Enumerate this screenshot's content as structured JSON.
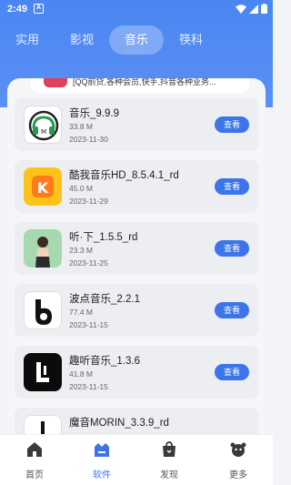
{
  "status": {
    "time": "2:49",
    "badge": "A"
  },
  "tabs": [
    {
      "label": "实用"
    },
    {
      "label": "影视"
    },
    {
      "label": "音乐"
    },
    {
      "label": "筷科"
    }
  ],
  "peek_text": "[QQ前贷,各种会员,快手,抖音各种业务...",
  "apps": [
    {
      "name": "音乐_9.9.9",
      "size": "33.8 M",
      "date": "2023-11-30",
      "button": "查看",
      "icon": "headphones-icon"
    },
    {
      "name": "酷我音乐HD_8.5.4.1_rd",
      "size": "45.0 M",
      "date": "2023-11-29",
      "button": "查看",
      "icon": "kuwo-logo-icon"
    },
    {
      "name": "听·下_1.5.5_rd",
      "size": "23.3 M",
      "date": "2023-11-25",
      "button": "查看",
      "icon": "singer-illustration-icon"
    },
    {
      "name": "波点音乐_2.2.1",
      "size": "77.4 M",
      "date": "2023-11-15",
      "button": "查看",
      "icon": "bodian-logo-icon"
    },
    {
      "name": "趣听音乐_1.3.6",
      "size": "41.8 M",
      "date": "2023-11-15",
      "button": "查看",
      "icon": "quting-logo-icon"
    },
    {
      "name": "魔音MORIN_3.3.9_rd",
      "size": "",
      "date": "",
      "button": "",
      "icon": "morin-logo-icon"
    }
  ],
  "nav": [
    {
      "label": "首页",
      "icon": "home-icon"
    },
    {
      "label": "软件",
      "icon": "software-icon"
    },
    {
      "label": "发现",
      "icon": "discover-bag-icon"
    },
    {
      "label": "更多",
      "icon": "more-mascot-icon"
    }
  ],
  "colors": {
    "primary": "#3c75ea",
    "header": "#4a86f2"
  }
}
